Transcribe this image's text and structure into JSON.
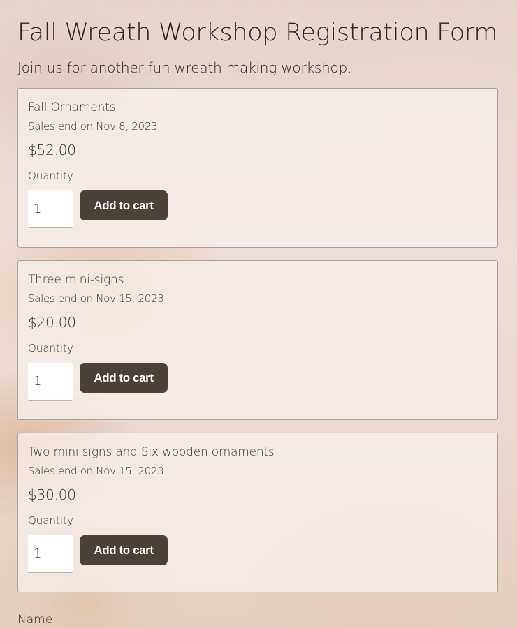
{
  "form": {
    "title": "Fall Wreath Workshop Registration Form",
    "subtitle": "Join us for another fun wreath making workshop."
  },
  "tickets": [
    {
      "name": "Fall Ornaments",
      "sales_end": "Sales end on Nov 8, 2023",
      "price": "$52.00",
      "quantity_label": "Quantity",
      "quantity_value": "1",
      "button_label": "Add to cart"
    },
    {
      "name": "Three mini-signs",
      "sales_end": "Sales end on Nov 15, 2023",
      "price": "$20.00",
      "quantity_label": "Quantity",
      "quantity_value": "1",
      "button_label": "Add to cart"
    },
    {
      "name": "Two mini signs and Six wooden ornaments",
      "sales_end": "Sales end on Nov 15, 2023",
      "price": "$30.00",
      "quantity_label": "Quantity",
      "quantity_value": "1",
      "button_label": "Add to cart"
    }
  ],
  "fields": {
    "name_label": "Name"
  },
  "colors": {
    "button_bg": "#4a4238",
    "card_border": "#a8a09a"
  }
}
